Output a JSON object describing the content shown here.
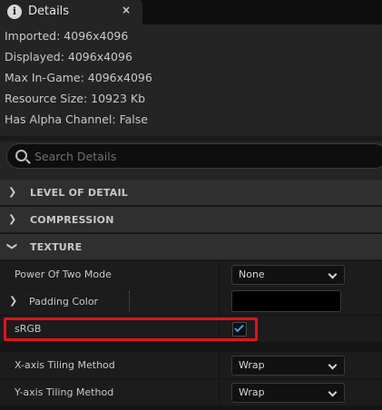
{
  "tab": {
    "icon": "info-icon",
    "icon_glyph": "i",
    "title": "Details",
    "close_glyph": "×"
  },
  "info": {
    "imported": "Imported: 4096x4096",
    "displayed": "Displayed: 4096x4096",
    "max_in_game": "Max In-Game: 4096x4096",
    "resource_size": "Resource Size: 10923 Kb",
    "has_alpha": "Has Alpha Channel: False"
  },
  "search": {
    "placeholder": "Search Details"
  },
  "categories": {
    "level_of_detail": {
      "label": "LEVEL OF DETAIL",
      "chevron": "❯",
      "expanded": false
    },
    "compression": {
      "label": "COMPRESSION",
      "chevron": "❯",
      "expanded": false
    },
    "texture": {
      "label": "TEXTURE",
      "chevron": "❯",
      "expanded": true
    }
  },
  "properties": {
    "power_of_two": {
      "label": "Power Of Two Mode",
      "value": "None"
    },
    "padding_color": {
      "label": "Padding Color",
      "chevron": "❯",
      "color": "#000000"
    },
    "srgb": {
      "label": "sRGB",
      "checked": true
    },
    "x_tiling": {
      "label": "X-axis Tiling Method",
      "value": "Wrap"
    },
    "y_tiling": {
      "label": "Y-axis Tiling Method",
      "value": "Wrap"
    }
  },
  "colors": {
    "accent_check": "#3fa0e8",
    "highlight_box": "#e0141b"
  }
}
